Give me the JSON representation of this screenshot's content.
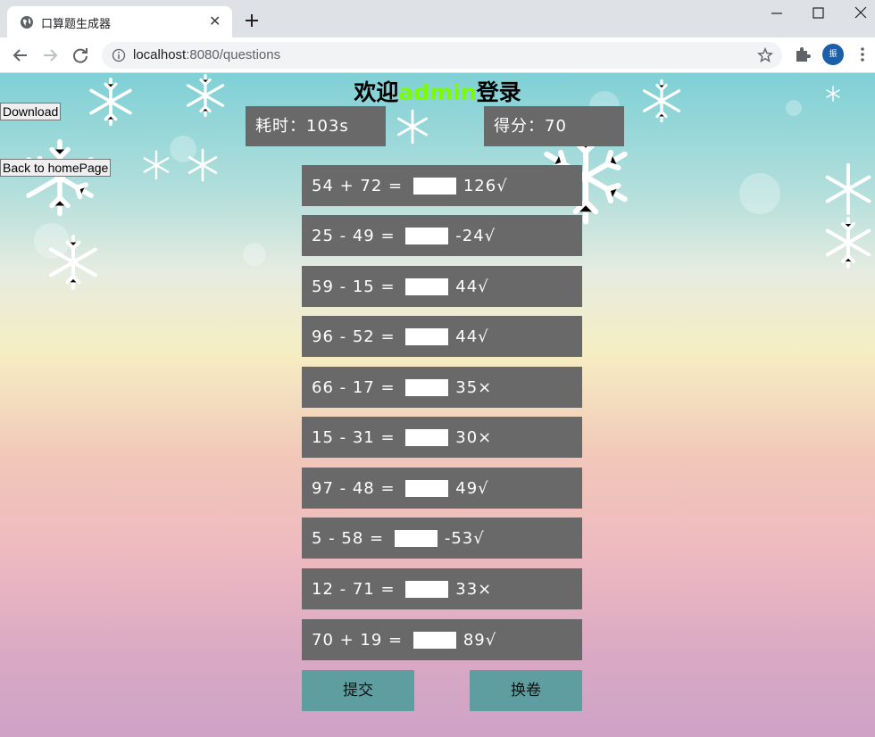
{
  "browser": {
    "tab_title": "口算题生成器",
    "url_host": "localhost",
    "url_path": ":8080/questions",
    "profile_initial": "振"
  },
  "page": {
    "welcome_prefix": "欢迎",
    "username": "admin",
    "welcome_suffix": "登录",
    "download_label": "Download",
    "home_label": "Back to homePage",
    "time_text": "耗时：103s",
    "score_text": "得分：70",
    "questions": [
      {
        "expr": "54 + 72 = ",
        "answer": "126√"
      },
      {
        "expr": "25 - 49 = ",
        "answer": "-24√"
      },
      {
        "expr": "59 - 15 = ",
        "answer": "44√"
      },
      {
        "expr": "96 - 52 = ",
        "answer": "44√"
      },
      {
        "expr": "66 - 17 = ",
        "answer": "35×"
      },
      {
        "expr": "15 - 31 = ",
        "answer": "30×"
      },
      {
        "expr": "97 - 48 = ",
        "answer": "49√"
      },
      {
        "expr": "5 - 58 = ",
        "answer": "-53√"
      },
      {
        "expr": "12 - 71 = ",
        "answer": "33×"
      },
      {
        "expr": "70 + 19 = ",
        "answer": "89√"
      }
    ],
    "submit_label": "提交",
    "change_label": "换卷"
  },
  "colors": {
    "panel": "#696969",
    "button": "#5f9ea0",
    "username": "#7cfc00"
  }
}
